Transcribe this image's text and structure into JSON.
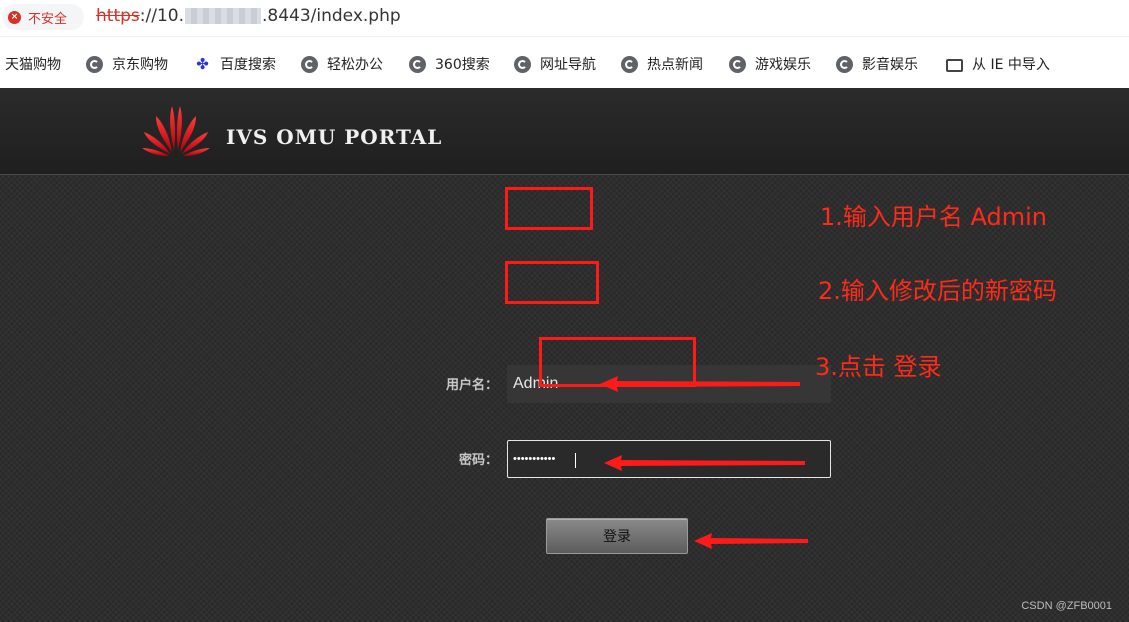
{
  "browser": {
    "security_label": "不安全",
    "url_scheme": "https",
    "url_host_prefix": "://10.",
    "url_suffix": ".8443/index.php",
    "bookmarks": [
      {
        "label": "天猫购物",
        "icon": "none"
      },
      {
        "label": "京东购物",
        "icon": "globe-icon"
      },
      {
        "label": "百度搜索",
        "icon": "baidu-paw-icon"
      },
      {
        "label": "轻松办公",
        "icon": "globe-icon"
      },
      {
        "label": "360搜索",
        "icon": "globe-icon"
      },
      {
        "label": "网址导航",
        "icon": "globe-icon"
      },
      {
        "label": "热点新闻",
        "icon": "globe-icon"
      },
      {
        "label": "游戏娱乐",
        "icon": "globe-icon"
      },
      {
        "label": "影音娱乐",
        "icon": "globe-icon"
      },
      {
        "label": "从 IE 中导入",
        "icon": "folder-icon"
      }
    ]
  },
  "portal": {
    "title": "IVS OMU PORTAL",
    "logo_color": "#e60012",
    "username_label": "用户名：",
    "username_value": "Admin",
    "password_label": "密码：",
    "password_mask": "•••••••••••",
    "login_label": "登录"
  },
  "annotations": {
    "color": "#ff1a1a",
    "step1": "1.输入用户名 Admin",
    "step2": "2.输入修改后的新密码",
    "step3": "3.点击 登录"
  },
  "watermark": "CSDN @ZFB0001"
}
